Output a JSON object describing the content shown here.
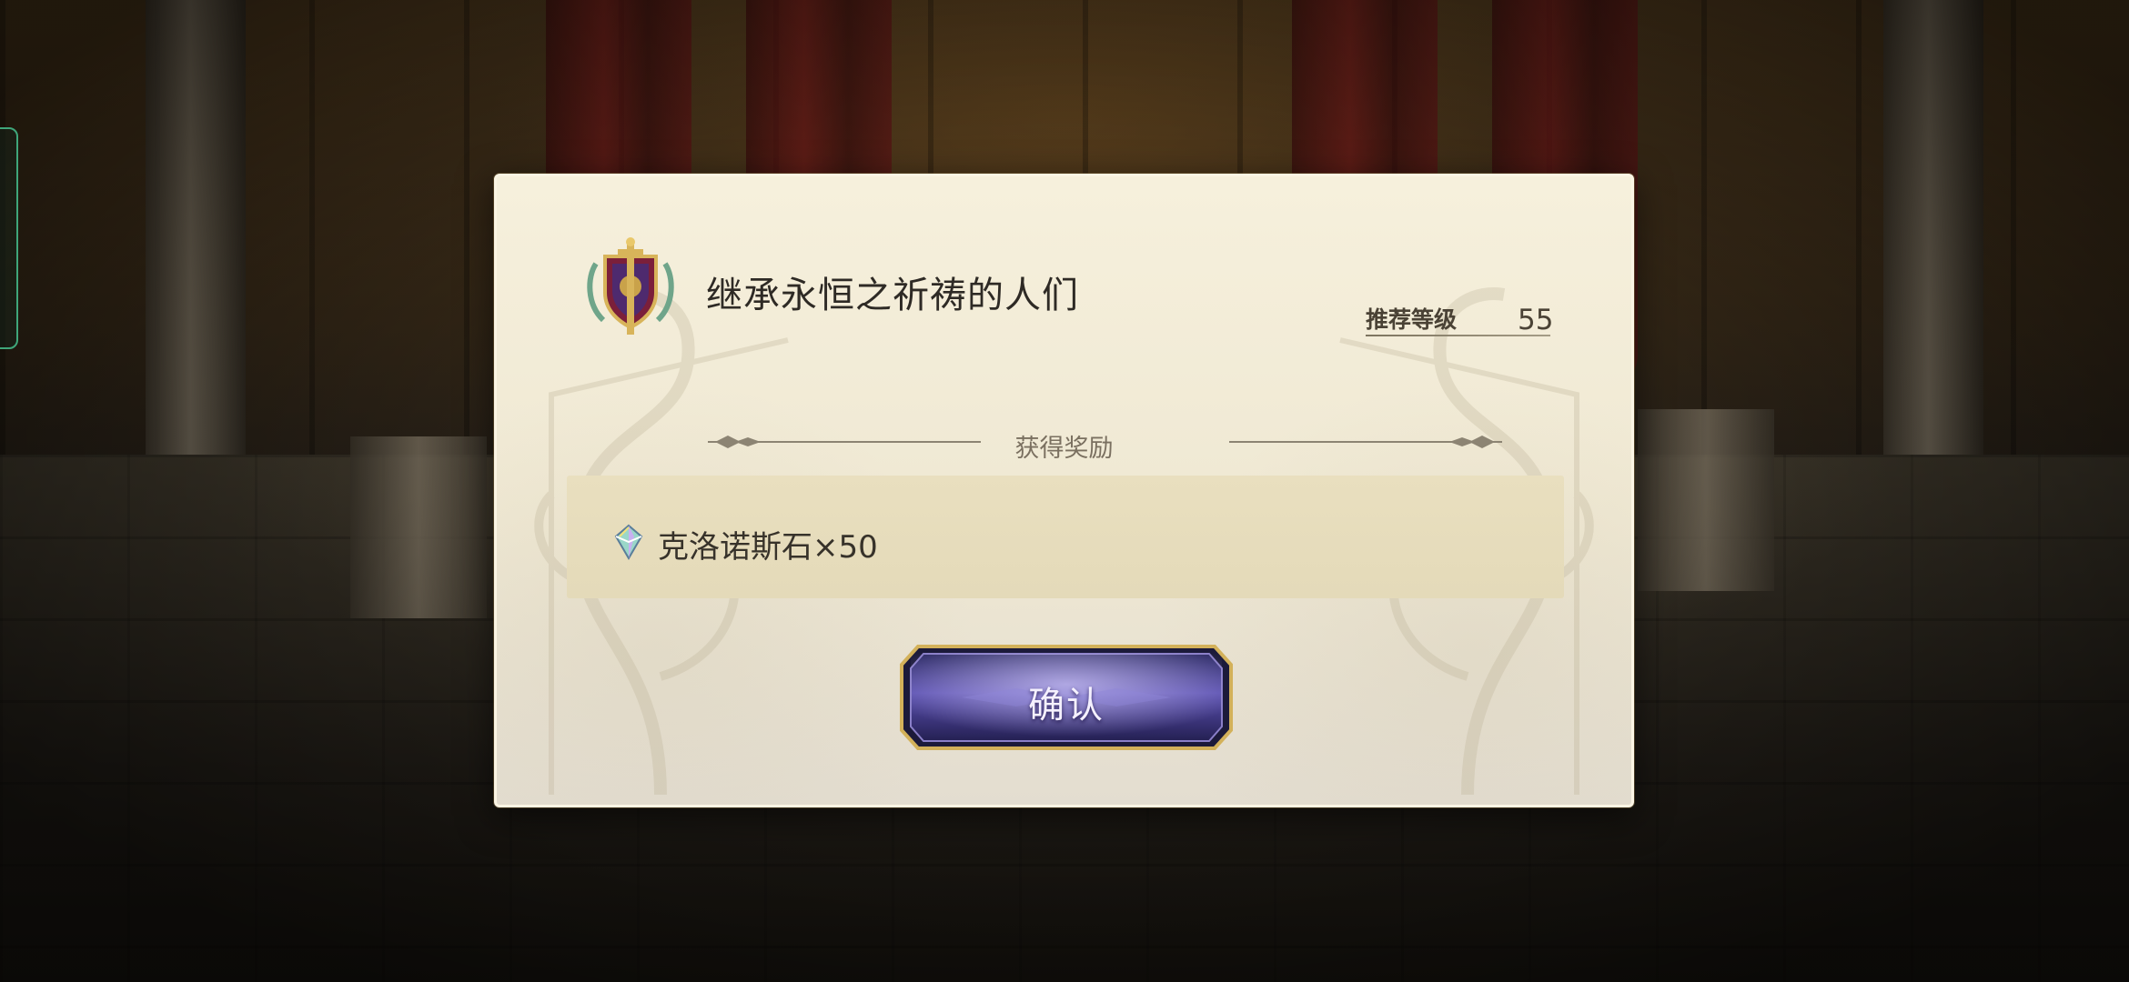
{
  "dialog": {
    "title": "继承永恒之祈祷的人们",
    "recommended_level_label": "推荐等级",
    "recommended_level_value": "55",
    "section_title": "获得奖励",
    "rewards": [
      {
        "icon": "chronos-stone-gem-icon",
        "text": "克洛诺斯石×50"
      }
    ],
    "confirm_label": "确认"
  },
  "colors": {
    "dialog_bg": "#f2ecd8",
    "reward_bg": "#e7ddbc",
    "button_purple": "#4b3d8f",
    "button_gold": "#c9a24a",
    "side_tab_green": "#3fa67a"
  }
}
